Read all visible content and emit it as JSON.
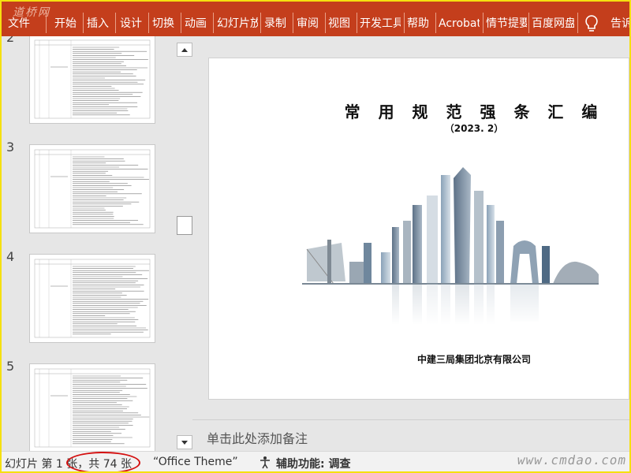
{
  "ribbon": {
    "watermark": "道桥网",
    "tabs": [
      "文件",
      "开始",
      "插入",
      "设计",
      "切换",
      "动画",
      "幻灯片放映",
      "录制",
      "审阅",
      "视图",
      "开发工具",
      "帮助",
      "Acrobat",
      "情节提要",
      "百度网盘"
    ],
    "tell_me": "告诉",
    "bg_color": "#c43e1c"
  },
  "thumbnails": {
    "slides": [
      {
        "number": "2"
      },
      {
        "number": "3"
      },
      {
        "number": "4"
      },
      {
        "number": "5"
      }
    ]
  },
  "slide": {
    "title": "常 用 规 范 强 条 汇 编",
    "date": "（2023. 2）",
    "company": "中建三局集团北京有限公司"
  },
  "notes": {
    "placeholder": "单击此处添加备注"
  },
  "status": {
    "slide_info": "幻灯片 第 1 张，共 74 张",
    "theme": "“Office Theme”",
    "accessibility": "辅助功能: 调查",
    "watermark": "www.cmdao.com"
  }
}
